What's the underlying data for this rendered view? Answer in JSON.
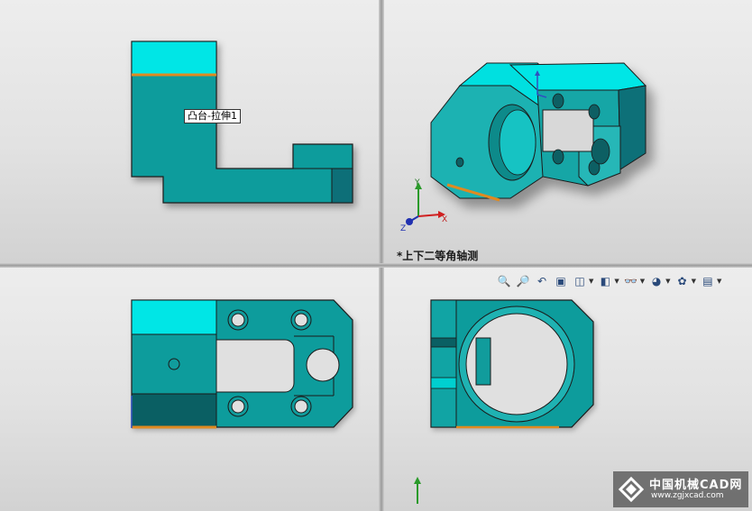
{
  "tooltip": {
    "feature_label": "凸台-拉伸1"
  },
  "top_right": {
    "view_label": "*上下二等角轴测"
  },
  "triad": {
    "x_label": "X",
    "y_label": "Y",
    "z_label": "Z"
  },
  "toolbar": {
    "items": [
      {
        "icon": "zoom-to-fit-icon"
      },
      {
        "icon": "zoom-to-area-icon"
      },
      {
        "icon": "previous-view-icon"
      },
      {
        "icon": "section-view-icon"
      },
      {
        "icon": "view-orientation-icon",
        "dropdown": true
      },
      {
        "icon": "display-style-icon",
        "dropdown": true
      },
      {
        "icon": "hide-show-items-icon",
        "dropdown": true
      },
      {
        "icon": "edit-appearance-icon",
        "dropdown": true
      },
      {
        "icon": "apply-scene-icon",
        "dropdown": true
      },
      {
        "icon": "view-settings-icon",
        "dropdown": true
      }
    ]
  },
  "watermark": {
    "site_name_cn": "中国机械CAD网",
    "site_url": "www.zgjxcad.com"
  },
  "colors": {
    "face_main": "#119c9c",
    "face_light": "#00e6e6",
    "face_dark": "#0a5f63",
    "highlight_edge": "#e08a20",
    "outline": "#1a1a1a"
  }
}
